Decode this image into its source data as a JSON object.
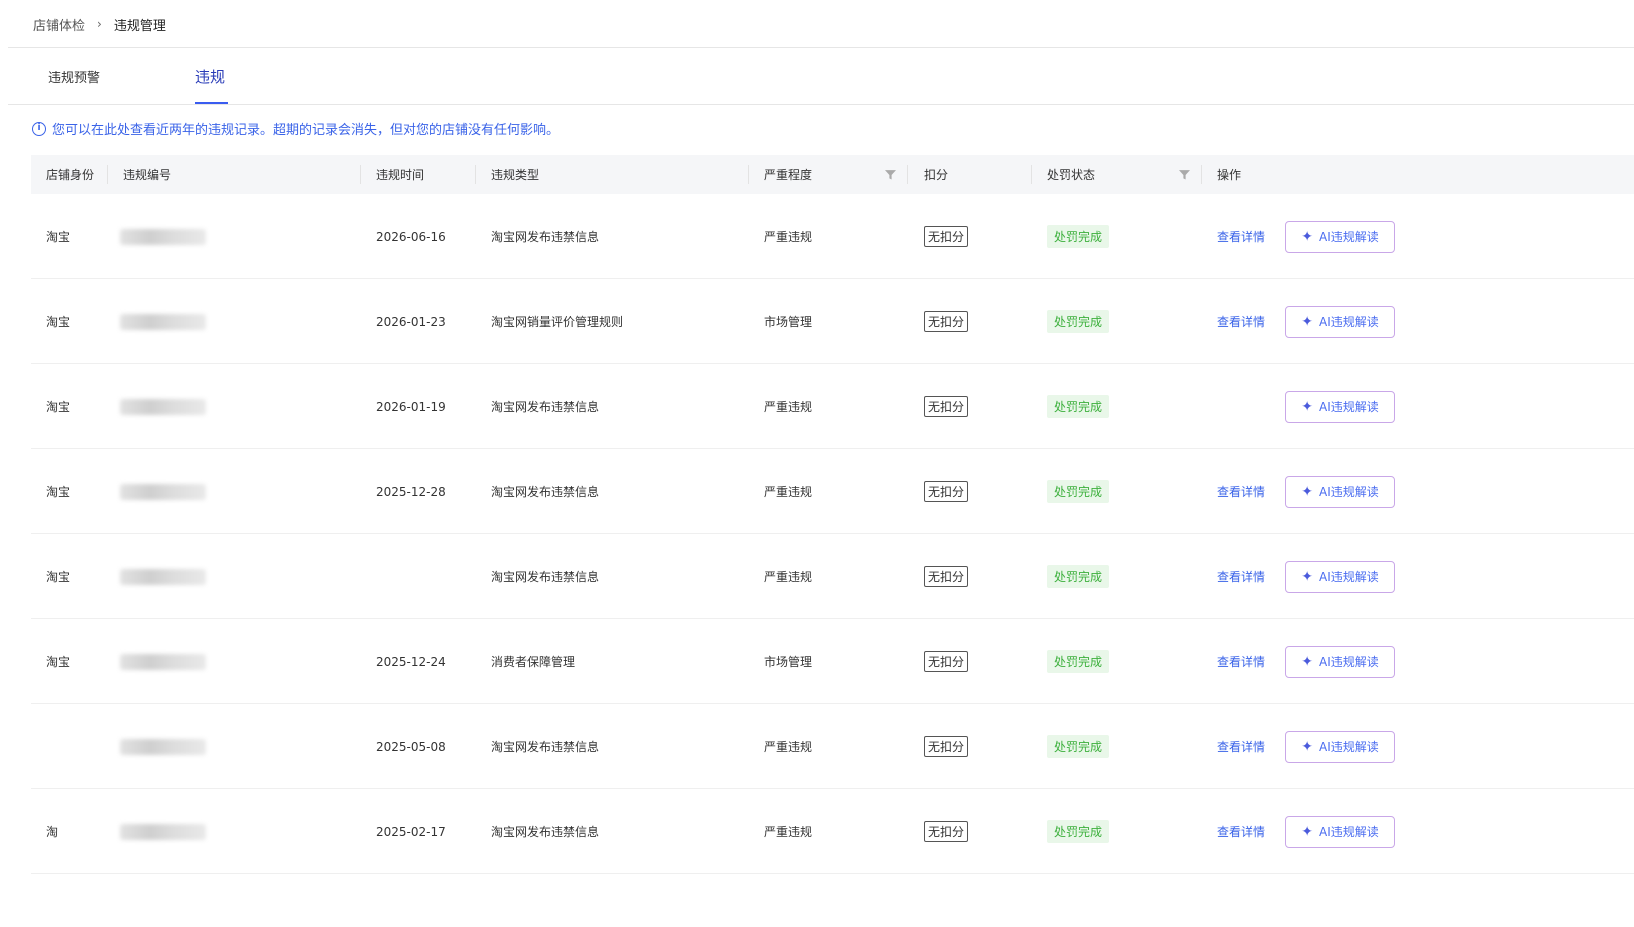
{
  "breadcrumb": {
    "parent": "店铺体检",
    "separator": "›",
    "current": "违规管理"
  },
  "tabs": [
    {
      "label": "违规预警",
      "active": false
    },
    {
      "label": "违规",
      "active": true
    }
  ],
  "notice": {
    "icon": "info-circle-icon",
    "text": "您可以在此处查看近两年的违规记录。超期的记录会消失，但对您的店铺没有任何影响。"
  },
  "table": {
    "columns": [
      "店铺身份",
      "违规编号",
      "违规时间",
      "违规类型",
      "严重程度",
      "扣分",
      "处罚状态",
      "操作"
    ],
    "rows": [
      {
        "shop": "淘宝",
        "date": "2026-06-16",
        "type": "淘宝网发布违禁信息",
        "severity": "严重违规",
        "deduct": "无扣分",
        "status": "处罚完成",
        "detail": "查看详情",
        "ai": "AI违规解读"
      },
      {
        "shop": "淘宝",
        "date": "2026-01-23",
        "type": "淘宝网销量评价管理规则",
        "severity": "市场管理",
        "deduct": "无扣分",
        "status": "处罚完成",
        "detail": "查看详情",
        "ai": "AI违规解读"
      },
      {
        "shop": "淘宝",
        "date": "2026-01-19",
        "type": "淘宝网发布违禁信息",
        "severity": "严重违规",
        "deduct": "无扣分",
        "status": "处罚完成",
        "detail": "",
        "ai": "AI违规解读"
      },
      {
        "shop": "淘宝",
        "date": "2025-12-28",
        "type": "淘宝网发布违禁信息",
        "severity": "严重违规",
        "deduct": "无扣分",
        "status": "处罚完成",
        "detail": "查看详情",
        "ai": "AI违规解读"
      },
      {
        "shop": "淘宝",
        "date": "",
        "type": "淘宝网发布违禁信息",
        "severity": "严重违规",
        "deduct": "无扣分",
        "status": "处罚完成",
        "detail": "查看详情",
        "ai": "AI违规解读"
      },
      {
        "shop": "淘宝",
        "date": "2025-12-24",
        "type": "消费者保障管理",
        "severity": "市场管理",
        "deduct": "无扣分",
        "status": "处罚完成",
        "detail": "查看详情",
        "ai": "AI违规解读"
      },
      {
        "shop": "",
        "date": "2025-05-08",
        "type": "淘宝网发布违禁信息",
        "severity": "严重违规",
        "deduct": "无扣分",
        "status": "处罚完成",
        "detail": "查看详情",
        "ai": "AI违规解读"
      },
      {
        "shop": "淘",
        "date": "2025-02-17",
        "type": "淘宝网发布违禁信息",
        "severity": "严重违规",
        "deduct": "无扣分",
        "status": "处罚完成",
        "detail": "查看详情",
        "ai": "AI违规解读"
      }
    ]
  },
  "icons": {
    "filter": "filter-icon",
    "ai": "sparkle-icon"
  },
  "colors": {
    "accent": "#3a63e8",
    "status_bg": "#e9f7e9",
    "status_text": "#3db03d",
    "ai_border": "#c9a7e8"
  }
}
